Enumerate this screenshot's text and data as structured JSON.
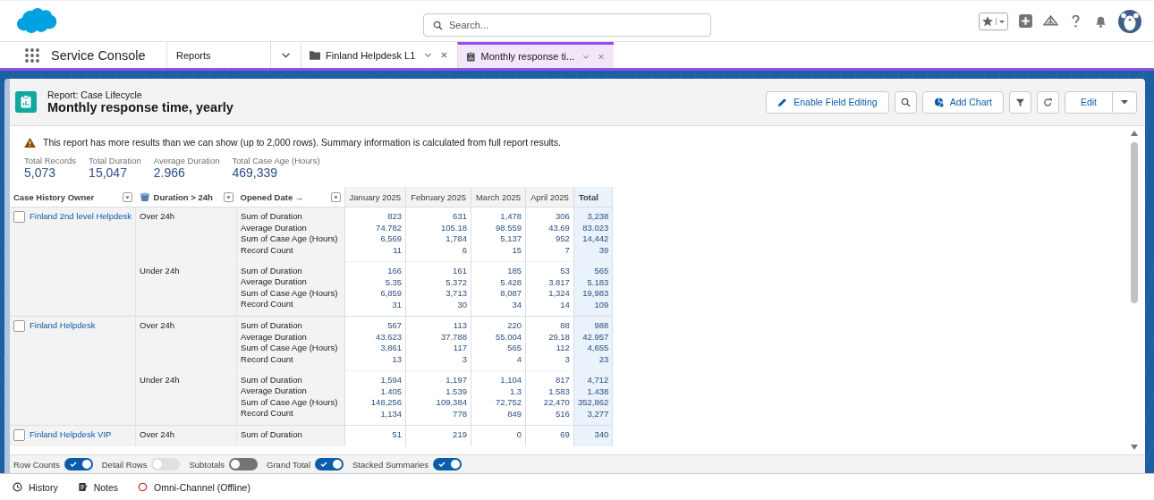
{
  "header": {
    "search": {
      "placeholder": "Search..."
    }
  },
  "nav": {
    "app_name": "Service Console",
    "nav_item": "Reports",
    "tabs": [
      {
        "label": "Finland Helpdesk L1",
        "kind": "folder",
        "selected": false
      },
      {
        "label": "Monthly response ti...",
        "kind": "report",
        "selected": true
      }
    ]
  },
  "report": {
    "type_label": "Report: Case Lifecycle",
    "title": "Monthly response time, yearly",
    "actions": [
      {
        "kind": "edit-fields",
        "label": "Enable Field Editing"
      },
      {
        "kind": "search"
      },
      {
        "kind": "chart",
        "label": "Add Chart"
      },
      {
        "kind": "filter"
      },
      {
        "kind": "refresh"
      },
      {
        "kind": "split",
        "label": "Edit"
      }
    ]
  },
  "warning": "This report has more results than we can show (up to 2,000 rows). Summary information is calculated from full report results.",
  "summaries": [
    {
      "label": "Total Records",
      "value": "5,073"
    },
    {
      "label": "Total Duration",
      "value": "15,047"
    },
    {
      "label": "Average Duration",
      "value": "2.966"
    },
    {
      "label": "Total Case Age (Hours)",
      "value": "469,339"
    }
  ],
  "table": {
    "group_columns": [
      {
        "label": "Case History Owner",
        "kind": "plain"
      },
      {
        "label": "Duration > 24h",
        "kind": "bucket"
      },
      {
        "label": "Opened Date →",
        "kind": "plain"
      }
    ],
    "columns": [
      "January 2025",
      "February 2025",
      "March 2025",
      "April 2025",
      "Total"
    ],
    "owners": [
      {
        "name": "Finland 2nd level Helpdesk",
        "checked": false,
        "groups": [
          {
            "bucket": "Over 24h",
            "rows": [
              {
                "measure": "Sum of Duration",
                "values": [
                  "823",
                  "631",
                  "1,478",
                  "306",
                  "3,238"
                ]
              },
              {
                "measure": "Average Duration",
                "values": [
                  "74.782",
                  "105.18",
                  "98.559",
                  "43.69",
                  "83.023"
                ]
              },
              {
                "measure": "Sum of Case Age (Hours)",
                "values": [
                  "6,569",
                  "1,784",
                  "5,137",
                  "952",
                  "14,442"
                ]
              },
              {
                "measure": "Record Count",
                "values": [
                  "11",
                  "6",
                  "15",
                  "7",
                  "39"
                ]
              }
            ]
          },
          {
            "bucket": "Under 24h",
            "rows": [
              {
                "measure": "Sum of Duration",
                "values": [
                  "166",
                  "161",
                  "185",
                  "53",
                  "565"
                ]
              },
              {
                "measure": "Average Duration",
                "values": [
                  "5.35",
                  "5.372",
                  "5.428",
                  "3.817",
                  "5.183"
                ]
              },
              {
                "measure": "Sum of Case Age (Hours)",
                "values": [
                  "6,859",
                  "3,713",
                  "8,087",
                  "1,324",
                  "19,983"
                ]
              },
              {
                "measure": "Record Count",
                "values": [
                  "31",
                  "30",
                  "34",
                  "14",
                  "109"
                ]
              }
            ]
          }
        ]
      },
      {
        "name": "Finland Helpdesk",
        "checked": false,
        "groups": [
          {
            "bucket": "Over 24h",
            "rows": [
              {
                "measure": "Sum of Duration",
                "values": [
                  "567",
                  "113",
                  "220",
                  "88",
                  "988"
                ]
              },
              {
                "measure": "Average Duration",
                "values": [
                  "43.623",
                  "37.788",
                  "55.004",
                  "29.18",
                  "42.957"
                ]
              },
              {
                "measure": "Sum of Case Age (Hours)",
                "values": [
                  "3,861",
                  "117",
                  "565",
                  "112",
                  "4,655"
                ]
              },
              {
                "measure": "Record Count",
                "values": [
                  "13",
                  "3",
                  "4",
                  "3",
                  "23"
                ]
              }
            ]
          },
          {
            "bucket": "Under 24h",
            "rows": [
              {
                "measure": "Sum of Duration",
                "values": [
                  "1,594",
                  "1,197",
                  "1,104",
                  "817",
                  "4,712"
                ]
              },
              {
                "measure": "Average Duration",
                "values": [
                  "1.405",
                  "1.539",
                  "1.3",
                  "1.583",
                  "1.438"
                ]
              },
              {
                "measure": "Sum of Case Age (Hours)",
                "values": [
                  "148,256",
                  "109,384",
                  "72,752",
                  "22,470",
                  "352,862"
                ]
              },
              {
                "measure": "Record Count",
                "values": [
                  "1,134",
                  "778",
                  "849",
                  "516",
                  "3,277"
                ]
              }
            ]
          }
        ]
      },
      {
        "name": "Finland Helpdesk VIP",
        "checked": false,
        "groups": [
          {
            "bucket": "Over 24h",
            "rows": [
              {
                "measure": "Sum of Duration",
                "values": [
                  "51",
                  "219",
                  "0",
                  "69",
                  "340"
                ]
              }
            ]
          }
        ]
      }
    ]
  },
  "toggles": [
    {
      "label": "Row Counts",
      "on": true,
      "disabled": false
    },
    {
      "label": "Detail Rows",
      "on": false,
      "disabled": true
    },
    {
      "label": "Subtotals",
      "on": false,
      "disabled": false
    },
    {
      "label": "Grand Total",
      "on": true,
      "disabled": false
    },
    {
      "label": "Stacked Summaries",
      "on": true,
      "disabled": false
    }
  ],
  "utility_bar": [
    {
      "kind": "history",
      "label": "History"
    },
    {
      "kind": "notes",
      "label": "Notes"
    },
    {
      "kind": "omni",
      "label": "Omni-Channel (Offline)"
    }
  ]
}
